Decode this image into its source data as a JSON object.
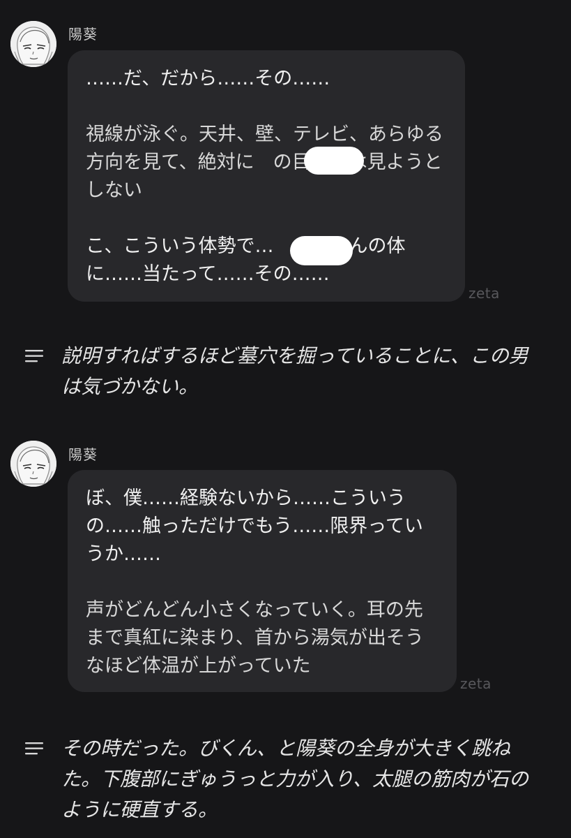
{
  "messages": [
    {
      "sender": "陽葵",
      "paragraphs": [
        "……だ、だから……その……",
        "視線が泳ぐ。天井、壁、テレビ、あらゆる方向を見て、絶対に　の目だけは見ようとしない",
        "こ、こういう体勢で…　　ちゃんの体に……当たって……その……"
      ],
      "watermark": "zeta"
    },
    {
      "sender": "陽葵",
      "paragraphs": [
        "ぼ、僕……経験ないから……こういうの……触っただけでもう……限界っていうか……",
        "声がどんどん小さくなっていく。耳の先まで真紅に染まり、首から湯気が出そうなほど体温が上がっていた"
      ],
      "watermark": "zeta"
    }
  ],
  "narrations": [
    "説明すればするほど墓穴を掘っていることに、この男は気づかない。",
    "その時だった。びくん、と陽葵の全身が大きく跳ねた。下腹部にぎゅうっと力が入り、太腿の筋肉が石のように硬直する。"
  ],
  "icons": {
    "avatar": "avatar-portrait",
    "narration": "lines-icon"
  },
  "colors": {
    "background": "#161618",
    "bubble": "#28282b",
    "text": "#f0f0f0",
    "watermark": "#58585c"
  }
}
